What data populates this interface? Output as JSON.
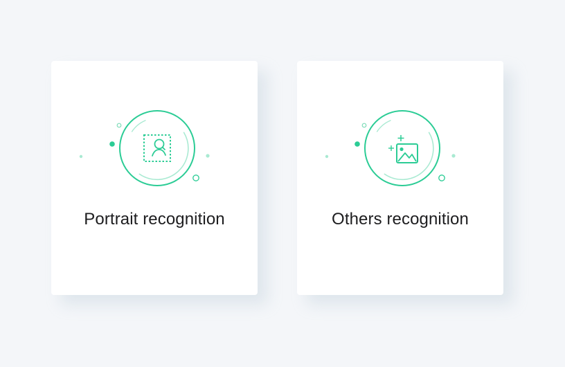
{
  "theme": {
    "background": "#f4f6f9",
    "card": "#ffffff",
    "accent": "#2bcc95",
    "accent_light": "#a9ead2",
    "text": "#1d1d1f"
  },
  "cards": [
    {
      "label": "Portrait recognition",
      "icon": "portrait-search-icon"
    },
    {
      "label": "Others recognition",
      "icon": "add-image-icon"
    }
  ]
}
